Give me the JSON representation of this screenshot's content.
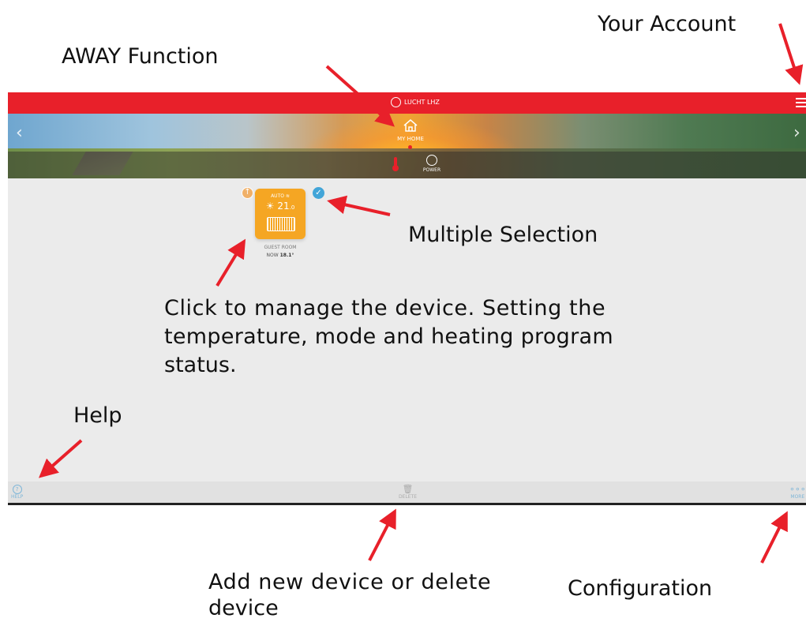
{
  "annotations": {
    "away": "AWAY Function",
    "account": "Your Account",
    "multiple": "Multiple Selection",
    "manage_line1": "Click to manage the device. Setting the",
    "manage_line2": "temperature, mode and heating program",
    "manage_line3": "status.",
    "help": "Help",
    "add_delete_line1": "Add new device or delete",
    "add_delete_line2": "device",
    "configuration": "Configuration"
  },
  "app": {
    "brand": "LUCHT LHZ",
    "home_label": "MY HOME",
    "tabs": [
      {
        "label": ""
      },
      {
        "label": "POWER"
      }
    ]
  },
  "device": {
    "mode": "AUTO",
    "setpoint": "21",
    "setpoint_decimal": ".0",
    "room": "GUEST ROOM",
    "now_label": "NOW",
    "now_value": "18.1°"
  },
  "bottom": {
    "help": "HELP",
    "delete": "DELETE",
    "more": "MORE"
  },
  "colors": {
    "topbar": "#e8202a",
    "device_tile": "#f5a623",
    "select_badge": "#42a5d8",
    "arrow": "#e8202a"
  }
}
